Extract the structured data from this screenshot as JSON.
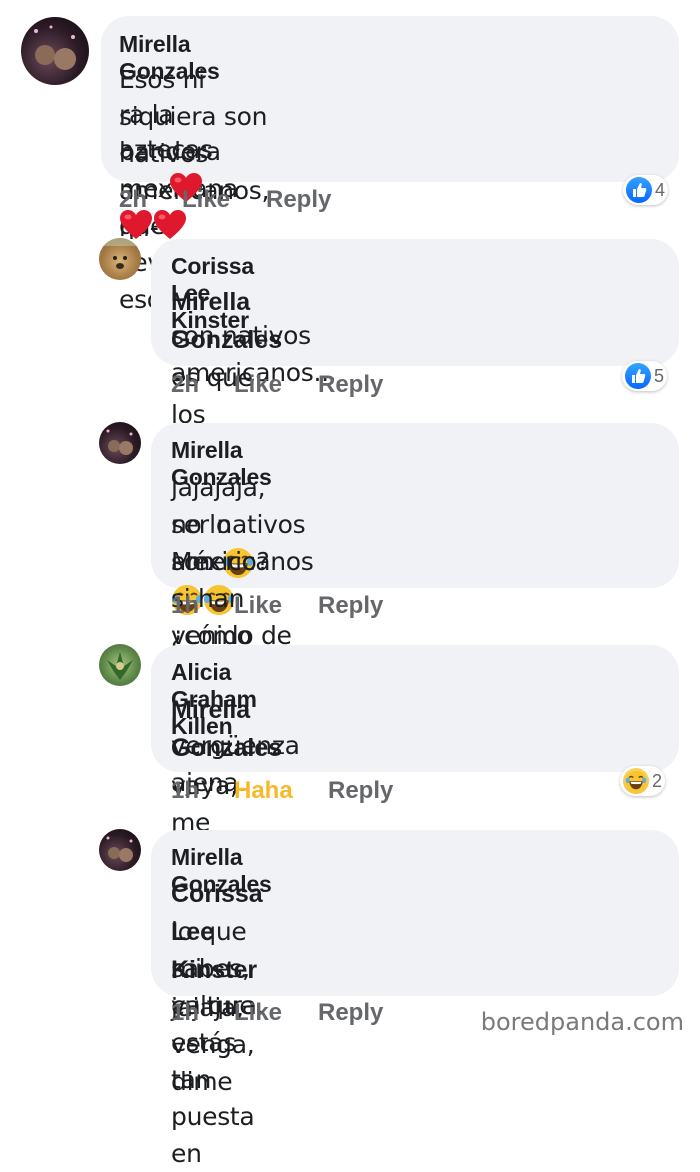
{
  "comments": [
    {
      "author": "Mirella Gonzales",
      "line1": "Esos ni siquiera son nativos americanos, mi-",
      "line2": "ra la bandera mexicana que llevan, esos son",
      "line3": "aztecas",
      "time": "2h",
      "like": "Like",
      "reply": "Reply",
      "reaction_icon": "like-icon",
      "reaction_count": "4"
    },
    {
      "author": "Corissa Lee Kinster",
      "tag": "Mirella Gonzales",
      "line1": "es que los Aztecas",
      "line2": "son nativos americanos...",
      "time": "2h",
      "like": "Like",
      "reply": "Reply",
      "reaction_icon": "like-icon",
      "reaction_count": "5"
    },
    {
      "author": "Mirella Gonzales",
      "line1a": "jajajaja, no lo son",
      "line1b": "¿cómo van a",
      "line2": "ser nativos americanos si han venido de",
      "line3": "México?",
      "time": "1h",
      "like": "Like",
      "reply": "Reply"
    },
    {
      "author": "Alicia Graham Killen",
      "tag": "Mirella Gonzales",
      "line1": "vaya, me estás dando",
      "line2": "vergüenza ajena.",
      "time": "1h",
      "like": "Haha",
      "reply": "Reply",
      "reaction_icon": "haha-icon",
      "reaction_count": "2"
    },
    {
      "author": "Mirella Gonzales",
      "tag": "Corissa Lee Kinster",
      "line1": "jajaja, venga, dime",
      "line2": "lo que sabes, ya que estás tan puesta en",
      "line3": "mi cultura.",
      "time": "1h",
      "like": "Like",
      "reply": "Reply"
    }
  ],
  "watermark": "boredpanda.com",
  "colors": {
    "bubble": "#f0f2f5",
    "action_text": "#65676b",
    "haha_active": "#f7b928",
    "like_blue": "#0866ff"
  }
}
